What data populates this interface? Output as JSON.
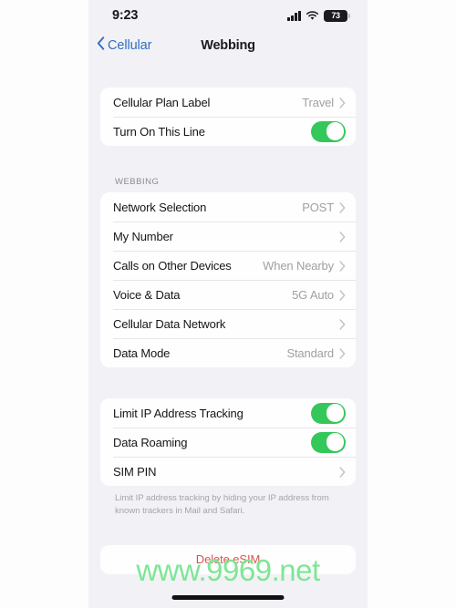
{
  "status_bar": {
    "time": "9:23",
    "cellular_icon": "signal-bars-icon",
    "wifi_icon": "wifi-icon",
    "battery_icon": "battery-icon",
    "battery_level": "73"
  },
  "nav": {
    "back_icon": "chevron-left-icon",
    "back_label": "Cellular",
    "title": "Webbing"
  },
  "groups": [
    {
      "header": "",
      "rows": [
        {
          "label": "Cellular Plan Label",
          "value": "Travel",
          "accessory": "chevron"
        },
        {
          "label": "Turn On This Line",
          "value": "",
          "accessory": "toggle",
          "on": true
        }
      ]
    },
    {
      "header": "WEBBING",
      "rows": [
        {
          "label": "Network Selection",
          "value": "POST",
          "accessory": "chevron"
        },
        {
          "label": "My Number",
          "value": "",
          "accessory": "chevron"
        },
        {
          "label": "Calls on Other Devices",
          "value": "When Nearby",
          "accessory": "chevron"
        },
        {
          "label": "Voice & Data",
          "value": "5G Auto",
          "accessory": "chevron"
        },
        {
          "label": "Cellular Data Network",
          "value": "",
          "accessory": "chevron"
        },
        {
          "label": "Data Mode",
          "value": "Standard",
          "accessory": "chevron"
        }
      ]
    },
    {
      "header": "",
      "rows": [
        {
          "label": "Limit IP Address Tracking",
          "value": "",
          "accessory": "toggle",
          "on": true
        },
        {
          "label": "Data Roaming",
          "value": "",
          "accessory": "toggle",
          "on": true
        },
        {
          "label": "SIM PIN",
          "value": "",
          "accessory": "chevron"
        }
      ],
      "footnote": "Limit IP address tracking by hiding your IP address from known trackers in Mail and Safari."
    }
  ],
  "delete_button": {
    "label": "Delete eSIM",
    "color": "#d9534f"
  },
  "watermark": {
    "text": "www.9969.net",
    "color": "#7ee695"
  },
  "colors": {
    "page_background": "#f2f2f6",
    "card_background": "#fefefe",
    "accent_blue": "#2f6fc0",
    "toggle_on": "#34c759",
    "value_gray": "#a0a0a5"
  }
}
